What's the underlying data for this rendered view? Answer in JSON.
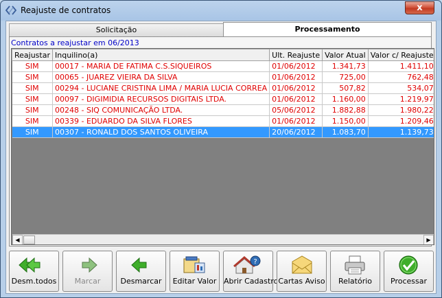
{
  "window": {
    "title": "Reajuste de contratos",
    "close_label": "x"
  },
  "tabs": [
    {
      "label": "Solicitação"
    },
    {
      "label": "Processamento"
    }
  ],
  "panel": {
    "label": "Contratos a reajustar em 06/2013"
  },
  "grid": {
    "columns": [
      "Reajustar",
      "Inquilino(a)",
      "Ult. Reajuste",
      "Valor Atual",
      "Valor c/ Reajuste"
    ],
    "rows": [
      [
        "SIM",
        "00017 - MARIA DE FATIMA C.S.SIQUEIROS",
        "01/06/2012",
        "1.341,73",
        "1.411,10"
      ],
      [
        "SIM",
        "00065 - JUAREZ VIEIRA DA SILVA",
        "01/06/2012",
        "725,00",
        "762,48"
      ],
      [
        "SIM",
        "00294 - LUCIANE CRISTINA LIMA / MARIA LUCIA CORREA",
        "01/06/2012",
        "507,82",
        "534,07"
      ],
      [
        "SIM",
        "00097 - DIGIMIDIA RECURSOS DIGITAIS LTDA.",
        "01/06/2012",
        "1.160,00",
        "1.219,97"
      ],
      [
        "SIM",
        "00248 - SIQ COMUNICAÇÃO LTDA.",
        "05/06/2012",
        "1.882,88",
        "1.980,22"
      ],
      [
        "SIM",
        "00339 - EDUARDO DA SILVA FLORES",
        "01/06/2012",
        "1.150,00",
        "1.209,46"
      ],
      [
        "SIM",
        "00307 - RONALD DOS SANTOS OLIVEIRA",
        "20/06/2012",
        "1.083,70",
        "1.139,73"
      ]
    ],
    "selected_row": 6
  },
  "buttons": {
    "desm_todos": "Desm.todos",
    "marcar": "Marcar",
    "desmarcar": "Desmarcar",
    "editar_valor": "Editar Valor",
    "abrir_cadastro": "Abrir Cadastro",
    "cartas_aviso": "Cartas Aviso",
    "relatorio": "Relatório",
    "processar": "Processar"
  },
  "icons": {
    "desm_todos": "double-left-arrow-icon",
    "marcar": "right-arrow-icon",
    "desmarcar": "left-arrow-icon",
    "editar_valor": "edit-value-icon",
    "abrir_cadastro": "open-record-icon",
    "cartas_aviso": "envelope-icon",
    "relatorio": "printer-icon",
    "processar": "checkmark-icon"
  },
  "colors": {
    "row_text": "#e00000",
    "selection": "#3399ff",
    "panel_label": "#0000c8"
  }
}
